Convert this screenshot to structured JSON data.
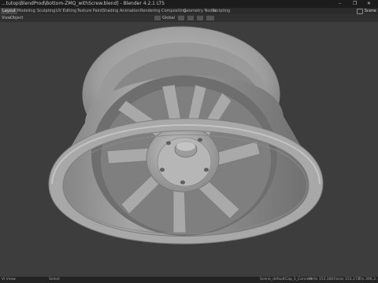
{
  "window": {
    "title": "...tutop\\BlendProd\\Bottom-ZMQ_withScrew.blend] - Blender 4.2.1 LTS",
    "controls": [
      "–",
      "❐",
      "✕"
    ]
  },
  "workspace_tabs": [
    "Layout",
    "Modeling",
    "Sculpting",
    "UV Editing",
    "Texture Paint",
    "Shading",
    "Animation",
    "Rendering",
    "Compositing",
    "Geometry Nodes",
    "Scripting"
  ],
  "active_tab": "Layout",
  "scene_label": "Scene",
  "header": {
    "view": "View",
    "object": "Object",
    "orientation": "Global",
    "icons": [
      "transform-orientation-icon",
      "pivot-icon",
      "snap-icon",
      "proportional-icon"
    ]
  },
  "statusbar": {
    "left": "Vi Vvew",
    "mid": "Select",
    "right1": "Scene_default",
    "right2": "Cap_1_Connect",
    "right3": "Verts 153,180",
    "right4": "Faces 153,172",
    "right5": "Tris 306,3..."
  },
  "colors": {
    "viewport_bg": "#3d3d3d",
    "mesh_light": "#b3b3b3",
    "mesh_mid": "#8f8f8f",
    "mesh_dark": "#5a5a5a"
  }
}
